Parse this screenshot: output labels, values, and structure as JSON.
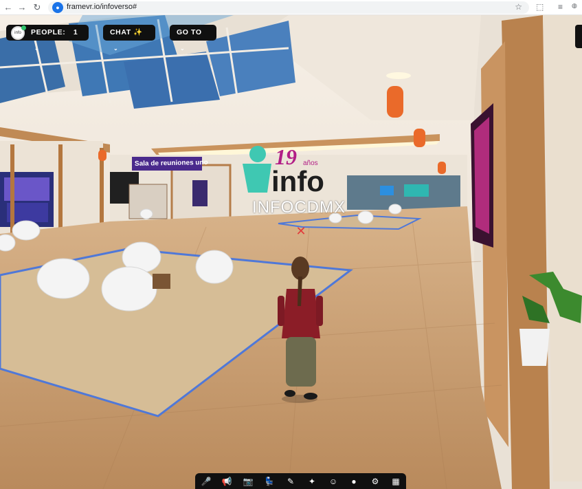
{
  "browser": {
    "url": "framevr.io/infoverso#",
    "back_icon": "←",
    "forward_icon": "→",
    "reload_icon": "↻",
    "star_icon": "☆"
  },
  "hud": {
    "people_label": "PEOPLE:",
    "people_count": "1",
    "chat_label": "CHAT ✨",
    "goto_label": "GO TO",
    "chevron": "⌄"
  },
  "scene": {
    "room_sign": "Sala de reuniones uno",
    "logo_number": "19",
    "logo_years": "años",
    "logo_word": "info",
    "logo_subtitle": "INFOCDMX"
  },
  "toolbar": {
    "mic_icon": "🎤",
    "megaphone_icon": "📢",
    "camera_icon": "📷",
    "seat_icon": "💺",
    "pen_icon": "✎",
    "sparkle_icon": "✦",
    "emoji_icon": "☺",
    "record_icon": "●",
    "gear_icon": "⚙",
    "grid_icon": "▦"
  },
  "colors": {
    "hud_bg": "#101010",
    "floor": "#c59a6d",
    "logo_teal": "#3fc8b2",
    "logo_magenta": "#b21e86"
  }
}
